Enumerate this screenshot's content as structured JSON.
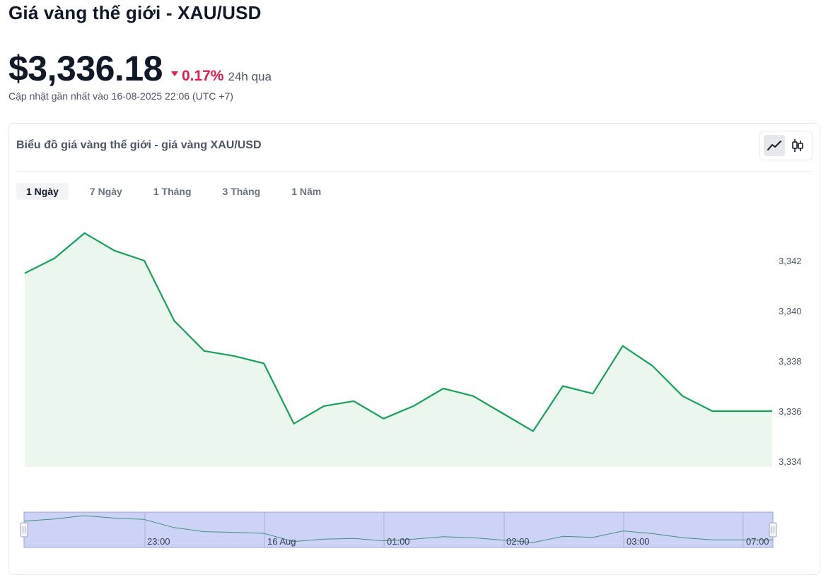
{
  "header": {
    "title": "Giá vàng thế giới - XAU/USD",
    "price": "$3,336.18",
    "change": "0.17%",
    "change_period": "24h qua",
    "updated": "Cập nhật gần nhất vào 16-08-2025 22:06 (UTC +7)"
  },
  "card": {
    "title": "Biểu đồ giá vàng thế giới - giá vàng XAU/USD",
    "chart_modes": [
      {
        "icon": "line-chart-icon",
        "active": true
      },
      {
        "icon": "candlestick-icon",
        "active": false
      }
    ],
    "tabs": [
      {
        "label": "1 Ngày",
        "active": true
      },
      {
        "label": "7 Ngày",
        "active": false
      },
      {
        "label": "1 Tháng",
        "active": false
      },
      {
        "label": "3 Tháng",
        "active": false
      },
      {
        "label": "1 Năm",
        "active": false
      }
    ]
  },
  "colors": {
    "line": "#16a05a",
    "area": "#eaf6ee",
    "down": "#e11d48",
    "zoom_fill": "#cdd3f7",
    "zoom_border": "#9aa3c9"
  },
  "chart_data": {
    "type": "area",
    "y_ticks": [
      3342,
      3340,
      3338,
      3336,
      3334
    ],
    "y_tick_labels": [
      "3,342",
      "3,340",
      "3,338",
      "3,336",
      "3,334"
    ],
    "ylim": [
      3333.8,
      3344.0
    ],
    "values": [
      3341.5,
      3342.1,
      3343.1,
      3342.4,
      3342.0,
      3339.6,
      3338.4,
      3338.2,
      3337.9,
      3335.5,
      3336.2,
      3336.4,
      3335.7,
      3336.2,
      3336.9,
      3336.6,
      3335.9,
      3335.2,
      3337.0,
      3336.7,
      3338.6,
      3337.8,
      3336.6,
      3336.0,
      3336.0,
      3336.0
    ],
    "zoom_x_labels": [
      "23:00",
      "16 Aug",
      "01:00",
      "02:00",
      "03:00",
      "07:00"
    ],
    "grid": false,
    "legend": "none"
  }
}
